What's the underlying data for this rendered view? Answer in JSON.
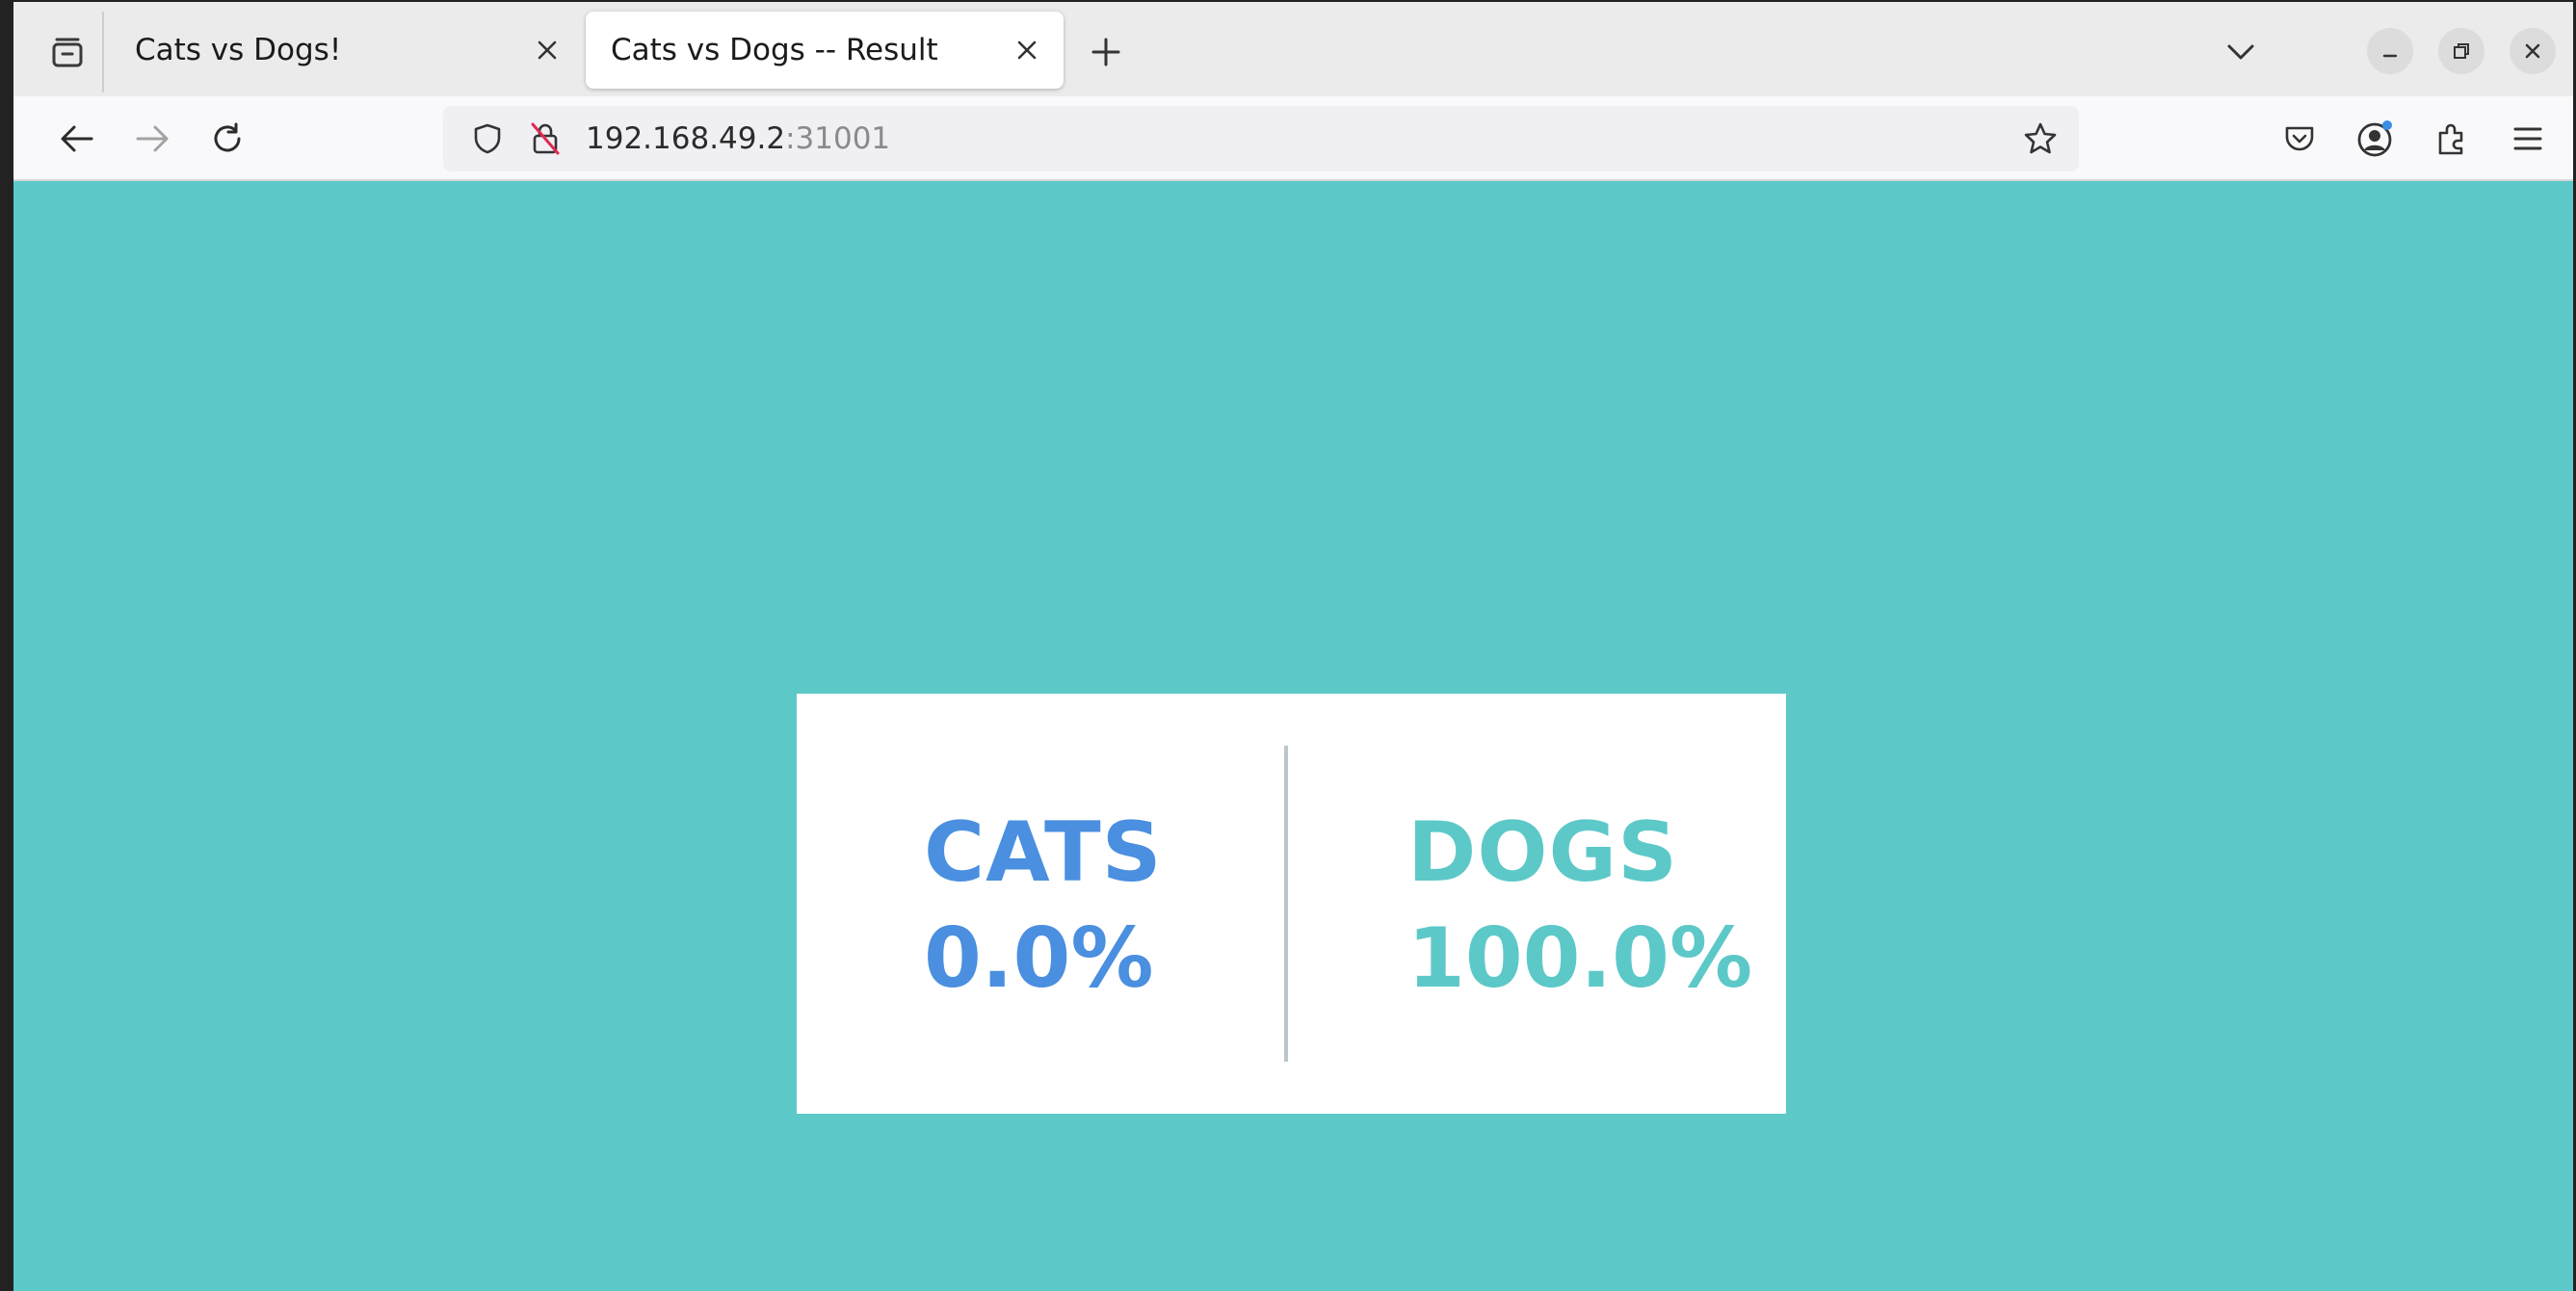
{
  "browser": {
    "tabs": [
      {
        "title": "Cats vs Dogs!",
        "active": false
      },
      {
        "title": "Cats vs Dogs -- Result",
        "active": true
      }
    ],
    "url": {
      "host": "192.168.49.2",
      "port": ":31001"
    },
    "icons": {
      "tab_list": "tab-list-icon",
      "new_tab": "plus-icon",
      "list_all_tabs": "chevron-down-icon",
      "minimize": "minimize-icon",
      "restore": "restore-icon",
      "close": "close-icon",
      "back": "arrow-left-icon",
      "forward": "arrow-right-icon",
      "reload": "reload-icon",
      "shield": "shield-icon",
      "insecure_lock": "insecure-lock-icon",
      "bookmark": "star-icon",
      "pocket": "pocket-icon",
      "account": "account-icon",
      "extensions": "puzzle-icon",
      "menu": "hamburger-menu-icon"
    }
  },
  "page": {
    "background_color": "#5dc8c8",
    "cats": {
      "label": "CATS",
      "percent": "0.0%",
      "color": "#4a8fe0"
    },
    "dogs": {
      "label": "DOGS",
      "percent": "100.0%",
      "color": "#5dc8c8"
    }
  }
}
